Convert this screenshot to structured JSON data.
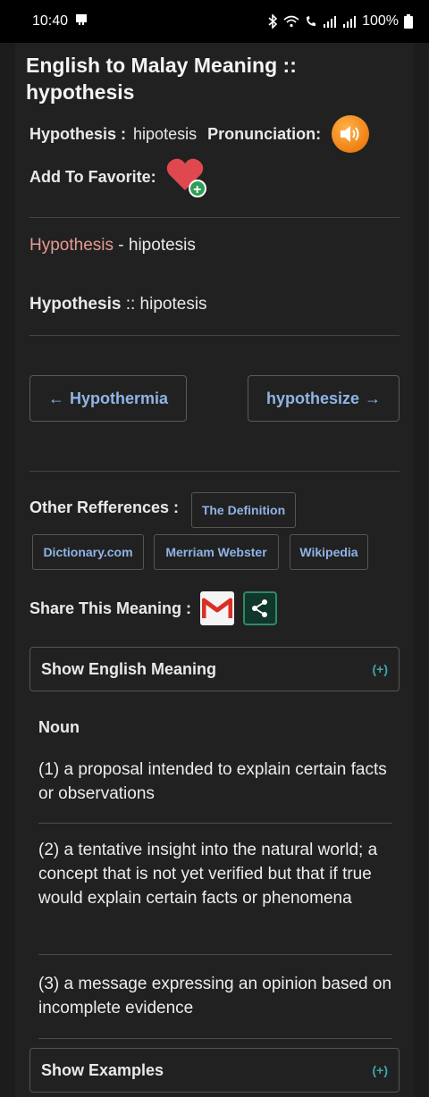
{
  "status": {
    "time": "10:40",
    "battery": "100%"
  },
  "title": {
    "line1": "English to Malay Meaning ::",
    "line2": "hypothesis"
  },
  "word_row": {
    "word_label": "Hypothesis :",
    "translation": "hipotesis",
    "pronunciation_label": "Pronunciation:"
  },
  "favorite": {
    "label": "Add To Favorite:"
  },
  "pair1": {
    "english": "Hypothesis",
    "separator": " - ",
    "malay": "hipotesis"
  },
  "pair2": {
    "english": "Hypothesis",
    "separator": " :: ",
    "malay": "hipotesis"
  },
  "nav": {
    "prev_label": "Hypothermia",
    "prev_arrow": "←",
    "next_label": "hypothesize",
    "next_arrow": "→"
  },
  "references": {
    "label": "Other Refferences :",
    "links": [
      "The Definition",
      "Dictionary.com",
      "Merriam Webster",
      "Wikipedia"
    ]
  },
  "share": {
    "label": "Share This Meaning :"
  },
  "english_meaning": {
    "header": "Show English Meaning",
    "toggle": "(+)",
    "part_of_speech": "Noun",
    "definitions": [
      "(1) a proposal intended to explain certain facts or observations",
      "(2) a tentative insight into the natural world; a concept that is not yet verified but that if true would explain certain facts or phenomena",
      "(3) a message expressing an opinion based on incomplete evidence"
    ]
  },
  "examples": {
    "header": "Show Examples",
    "toggle": "(+)"
  }
}
